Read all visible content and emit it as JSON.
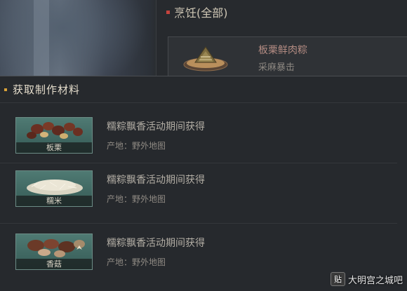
{
  "cook_panel": {
    "title": "烹饪(全部)",
    "recipe": {
      "name": "板栗鲜肉粽",
      "subtitle": "采麻暴击",
      "icon": "zongzi-dumpling-icon"
    }
  },
  "acquisition_panel": {
    "title": "获取制作材料",
    "materials": [
      {
        "name": "板栗",
        "icon": "chestnut-icon",
        "source": "糯粽飘香活动期间获得",
        "origin": "产地：野外地图"
      },
      {
        "name": "糯米",
        "icon": "glutinous-rice-icon",
        "source": "糯粽飘香活动期间获得",
        "origin": "产地：野外地图"
      },
      {
        "name": "香菇",
        "icon": "shiitake-mushroom-icon",
        "source": "糯粽飘香活动期间获得",
        "origin": "产地：野外地图"
      }
    ]
  },
  "watermark": {
    "badge": "贴",
    "text": "大明宫之城吧"
  },
  "colors": {
    "accent_red": "#c4433d",
    "accent_gold": "#d9a239",
    "recipe_name": "#b48c83"
  }
}
